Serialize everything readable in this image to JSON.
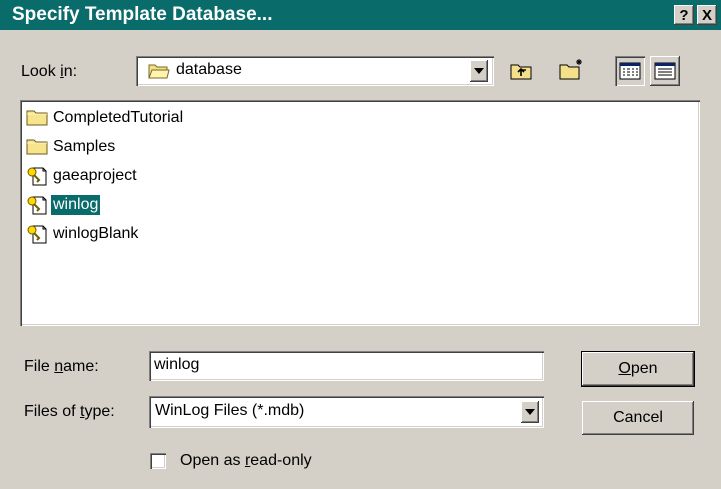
{
  "window": {
    "title": "Specify Template Database...",
    "help_button": "?",
    "close_button": "X"
  },
  "lookin": {
    "label_pre": "Look ",
    "label_accel": "i",
    "label_post": "n:",
    "value": "database"
  },
  "files": [
    {
      "name": "CompletedTutorial",
      "icon": "folder-icon"
    },
    {
      "name": "Samples",
      "icon": "folder-icon"
    },
    {
      "name": "gaeaproject",
      "icon": "database-file-icon"
    },
    {
      "name": "winlog",
      "icon": "database-file-icon",
      "selected": true
    },
    {
      "name": "winlogBlank",
      "icon": "database-file-icon"
    }
  ],
  "filename": {
    "label_pre": "File ",
    "label_accel": "n",
    "label_post": "ame:",
    "value": "winlog"
  },
  "filetype": {
    "label_pre": "Files of ",
    "label_accel": "t",
    "label_post": "ype:",
    "value": "WinLog Files (*.mdb)"
  },
  "readonly": {
    "label_pre": "Open as ",
    "label_accel": "r",
    "label_post": "ead-only",
    "checked": false
  },
  "buttons": {
    "open_accel": "O",
    "open_rest": "pen",
    "cancel": "Cancel"
  },
  "colors": {
    "titlebar": "#0a6b6b",
    "face": "#d4d0c8",
    "selection": "#0a6b6b"
  }
}
